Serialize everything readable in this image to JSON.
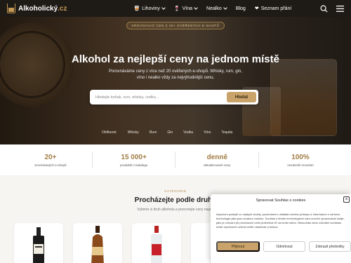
{
  "header": {
    "logo_text": "Alkoholický",
    "logo_tld": ".cz",
    "nav": [
      {
        "label": "Lihoviny",
        "emoji": "🥃",
        "dropdown": true
      },
      {
        "label": "Vína",
        "emoji": "🍷",
        "dropdown": true
      },
      {
        "label": "Nealko",
        "emoji": "",
        "dropdown": true
      },
      {
        "label": "Blog",
        "emoji": "",
        "dropdown": false
      },
      {
        "label": "Seznam přání",
        "emoji": "❤",
        "dropdown": false
      }
    ]
  },
  "hero": {
    "badge": "Srovnávač cen z 20+ ověřených e-shopů",
    "title": "Alkohol za nejlepší ceny na jednom místě",
    "subtitle": "Porovnáváme ceny z více než 20 ověřených e-shopů. Whisky, rum, gin, víno i nealko vždy za nejvýhodnější cenu.",
    "search_placeholder": "Hledejte koňak, rum, whisky, vodku...",
    "search_button": "Hledat",
    "quick_links": [
      "Oblíbené:",
      "Whisky",
      "Rum",
      "Gin",
      "Vodka",
      "Víno",
      "Tequila"
    ]
  },
  "stats": [
    {
      "value": "20+",
      "label": "srovnávaných e-shopů"
    },
    {
      "value": "15 000+",
      "label": "produktů v katalogu"
    },
    {
      "value": "denně",
      "label": "aktualizované ceny"
    },
    {
      "value": "100%",
      "label": "nezávislé srovnání"
    }
  ],
  "categories": {
    "kicker": "Kategorie",
    "title": "Procházejte podle druhu",
    "subtitle": "Vyberte si druh alkoholu a porovnejte ceny napříč"
  },
  "cookie": {
    "title": "Spravovat Souhlas s cookies",
    "text": "Abychom poskytli co nejlepší služby, používáme k ukládání a/nebo přístupu k informacím o zařízení, technologie jako jsou soubory cookies. Souhlas s těmito technologiemi nám umožní zpracovávat údaje, jako je chování při procházení nebo jedinečná ID na tomto webu. Nesouhlas nebo odvolání souhlasu může nepříznivě ovlivnit určité vlastnosti a funkce.",
    "accept": "Přijmout",
    "deny": "Odmítnout",
    "prefs": "Zobrazit předvolby"
  }
}
